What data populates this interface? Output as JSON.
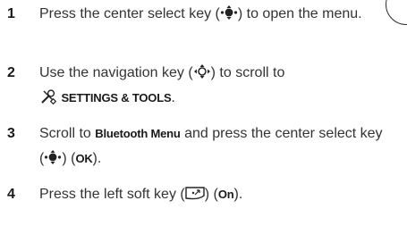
{
  "steps": [
    {
      "number": "1",
      "before": "Press the center select key (",
      "after": ") to open the menu."
    },
    {
      "number": "2",
      "line1_before": "Use the navigation key (",
      "line1_after": ") to scroll to",
      "menu_label": "SETTINGS & TOOLS",
      "period": "."
    },
    {
      "number": "3",
      "t1": "Scroll to ",
      "bold1": "Bluetooth Menu",
      "t2": " and press the center select key (",
      "t3": ") (",
      "bold2": "OK",
      "t4": ")."
    },
    {
      "number": "4",
      "t1": "Press the left soft key (",
      "t2": ") (",
      "bold1": "On",
      "t3": ")."
    }
  ],
  "icons": {
    "center_select": "center-select-key-icon",
    "navigation": "navigation-key-icon",
    "settings_tools": "settings-tools-icon",
    "left_soft_key": "left-soft-key-icon"
  }
}
